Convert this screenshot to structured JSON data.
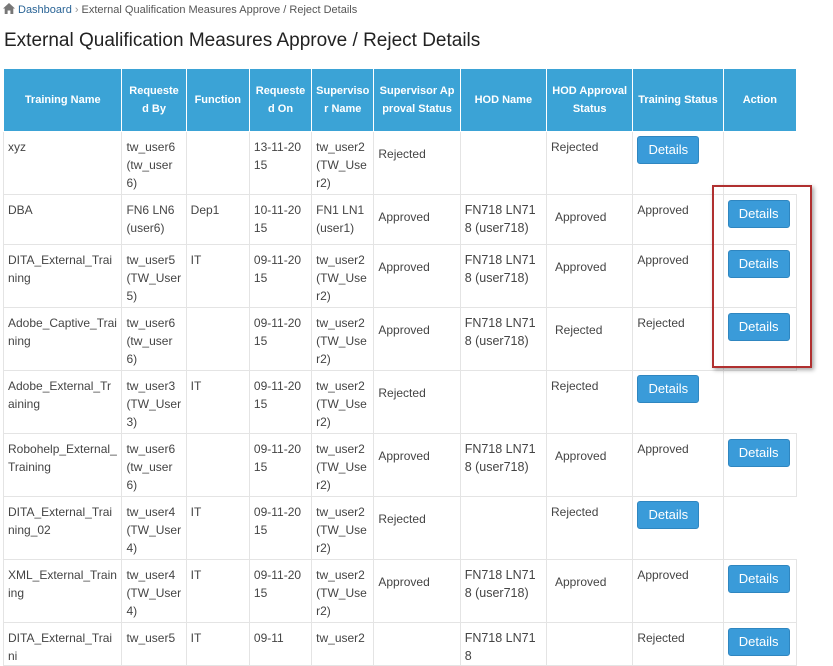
{
  "breadcrumb": {
    "home_label": "Dashboard",
    "current_label": "External Qualification Measures Approve / Reject Details"
  },
  "page_title": "External Qualification Measures Approve / Reject Details",
  "table": {
    "headers": {
      "training_name": "Training Name",
      "requested_by": "Requeste d By",
      "function": "Function",
      "requested_on": "Requeste d On",
      "supervisor_name": "Superviso r Name",
      "supervisor_approval_status": "Supervisor Approval Status",
      "hod_name": "HOD Name",
      "hod_approval_status": "HOD Approval Status",
      "training_status": "Training Status",
      "action": "Action"
    },
    "rows": [
      {
        "training_name": "xyz",
        "requested_by": "tw_user6 (tw_user6)",
        "function": "",
        "requested_on": "13-11-2015",
        "supervisor_name": "tw_user2 (TW_User2)",
        "supervisor_status": "Rejected",
        "hod_name": "",
        "hod_status": "Rejected",
        "training_status": "",
        "action": "Details"
      },
      {
        "training_name": "DBA",
        "requested_by": "FN6 LN6 (user6)",
        "function": "Dep1",
        "requested_on": "10-11-2015",
        "supervisor_name": "FN1 LN1 (user1)",
        "supervisor_status": "Approved",
        "hod_name": "FN718 LN718 (user718)",
        "hod_status": "Approved",
        "training_status": "Approved",
        "action": "Details"
      },
      {
        "training_name": "DITA_External_Training",
        "requested_by": "tw_user5 (TW_User5)",
        "function": "IT",
        "requested_on": "09-11-2015",
        "supervisor_name": "tw_user2 (TW_User2)",
        "supervisor_status": "Approved",
        "hod_name": "FN718 LN718 (user718)",
        "hod_status": "Approved",
        "training_status": "Approved",
        "action": "Details"
      },
      {
        "training_name": "Adobe_Captive_Training",
        "requested_by": "tw_user6 (tw_user6)",
        "function": "",
        "requested_on": "09-11-2015",
        "supervisor_name": "tw_user2 (TW_User2)",
        "supervisor_status": "Approved",
        "hod_name": "FN718 LN718 (user718)",
        "hod_status": "Rejected",
        "training_status": "Rejected",
        "action": "Details"
      },
      {
        "training_name": "Adobe_External_Training",
        "requested_by": "tw_user3 (TW_User3)",
        "function": "IT",
        "requested_on": "09-11-2015",
        "supervisor_name": "tw_user2 (TW_User2)",
        "supervisor_status": "Rejected",
        "hod_name": "",
        "hod_status": "Rejected",
        "training_status": "",
        "action": "Details"
      },
      {
        "training_name": "Robohelp_External_Training",
        "requested_by": "tw_user6 (tw_user6)",
        "function": "",
        "requested_on": "09-11-2015",
        "supervisor_name": "tw_user2 (TW_User2)",
        "supervisor_status": "Approved",
        "hod_name": "FN718 LN718 (user718)",
        "hod_status": "Approved",
        "training_status": "Approved",
        "action": "Details"
      },
      {
        "training_name": "DITA_External_Training_02",
        "requested_by": "tw_user4 (TW_User4)",
        "function": "IT",
        "requested_on": "09-11-2015",
        "supervisor_name": "tw_user2 (TW_User2)",
        "supervisor_status": "Rejected",
        "hod_name": "",
        "hod_status": "Rejected",
        "training_status": "",
        "action": "Details"
      },
      {
        "training_name": "XML_External_Training",
        "requested_by": "tw_user4 (TW_User4)",
        "function": "IT",
        "requested_on": "09-11-2015",
        "supervisor_name": "tw_user2 (TW_User2)",
        "supervisor_status": "Approved",
        "hod_name": "FN718 LN718 (user718)",
        "hod_status": "Approved",
        "training_status": "Approved",
        "action": "Details"
      },
      {
        "training_name": "DITA_External_Traini",
        "requested_by": "tw_user5",
        "function": "IT",
        "requested_on": "09-11",
        "supervisor_name": "tw_user2",
        "supervisor_status": "",
        "hod_name": "FN718 LN718",
        "hod_status": "",
        "training_status": "Rejected",
        "action": "Details"
      }
    ]
  },
  "colors": {
    "header_bg": "#3ba3d6",
    "button_bg": "#3a9bd9",
    "highlight_border": "#b03030"
  }
}
